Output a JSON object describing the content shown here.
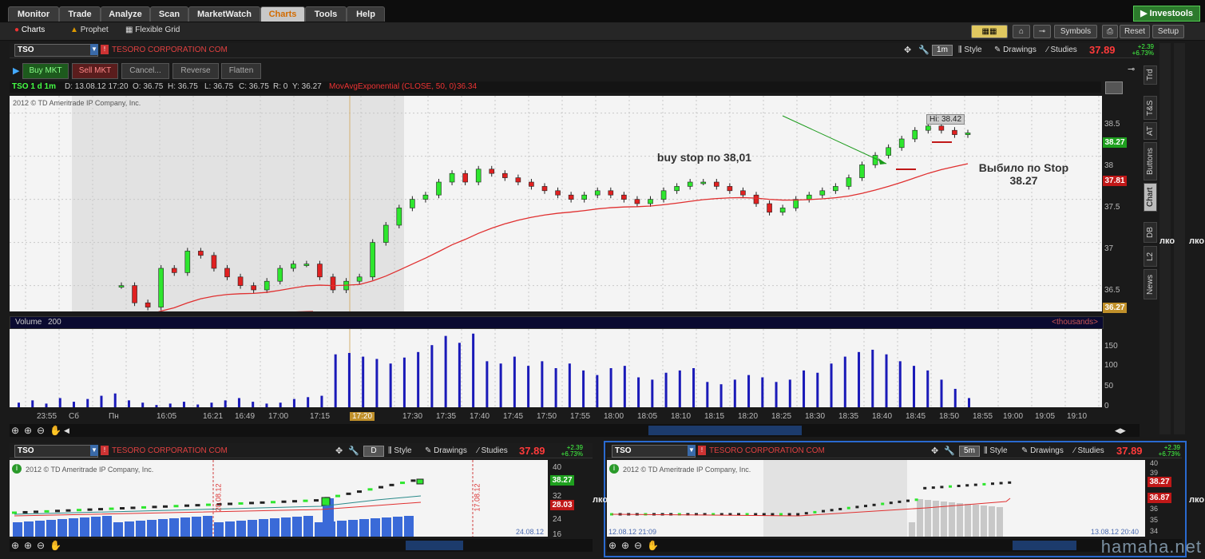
{
  "nav": {
    "tabs": [
      "Monitor",
      "Trade",
      "Analyze",
      "Scan",
      "MarketWatch",
      "Charts",
      "Tools",
      "Help"
    ],
    "active": "Charts",
    "brand": "Investools"
  },
  "subnav": {
    "charts": "Charts",
    "prophet": "Prophet",
    "flexible_grid": "Flexible Grid",
    "symbols": "Symbols",
    "reset": "Reset",
    "setup": "Setup"
  },
  "main_chart": {
    "symbol": "TSO",
    "company": "TESORO CORPORATION COM",
    "timeframe_btn": "1m",
    "style": "Style",
    "drawings": "Drawings",
    "studies": "Studies",
    "last_price": "37.89",
    "change_abs": "+2.39",
    "change_pct": "+6.73%",
    "buy_btn": "Buy MKT",
    "sell_btn": "Sell MKT",
    "cancel_btn": "Cancel...",
    "reverse_btn": "Reverse",
    "flatten_btn": "Flatten",
    "info": {
      "label": "TSO 1 d 1m",
      "date": "D: 13.08.12 17:20",
      "open": "O: 36.75",
      "high": "H: 36.75",
      "low": "L: 36.75",
      "close": "C: 36.75",
      "range": "R: 0",
      "y": "Y: 36.27",
      "study": "MovAvgExponential (CLOSE, 50, 0)",
      "study_val": "36.34"
    },
    "copyright": "2012 © TD Ameritrade IP Company, Inc.",
    "y_axis": [
      "38.5",
      "38",
      "37.5",
      "37",
      "36.5"
    ],
    "tag_last": "38.27",
    "tag_ma": "37.81",
    "tag_y": "36.27",
    "hi_label": "Hi: 38.42",
    "annotation1": "buy stop по 38,01",
    "annotation2_l1": "Выбило по Stop",
    "annotation2_l2": "38.27",
    "volume_label": "Volume",
    "volume_val": "200",
    "volume_units": "<thousands>",
    "volume_axis": [
      "150",
      "100",
      "50",
      "0"
    ],
    "time_labels": [
      "23:55",
      "Сб",
      "Пн",
      "16:05",
      "16:21",
      "16:49",
      "17:00",
      "17:15",
      "17:20",
      "17:30",
      "17:35",
      "17:40",
      "17:45",
      "17:50",
      "17:55",
      "18:00",
      "18:05",
      "18:10",
      "18:15",
      "18:20",
      "18:25",
      "18:30",
      "18:35",
      "18:40",
      "18:45",
      "18:50",
      "18:55",
      "19:00",
      "19:05",
      "19:10"
    ],
    "side_tabs": [
      "Trd",
      "T&S",
      "AT",
      "Buttons",
      "Chart",
      "DB",
      "L2",
      "News"
    ],
    "side_text": "лко"
  },
  "chart_data": [
    {
      "type": "candlestick",
      "title": "TSO 1 d 1m",
      "ylim": [
        36.2,
        38.7
      ],
      "study": "MovAvgExponential (CLOSE, 50, 0)",
      "annotations": [
        "buy stop по 38,01",
        "Выбило по Stop 38.27",
        "Hi: 38.42"
      ],
      "closes": [
        36.5,
        36.3,
        36.25,
        36.7,
        36.65,
        36.9,
        36.85,
        36.7,
        36.6,
        36.5,
        36.45,
        36.55,
        36.7,
        36.75,
        36.75,
        36.6,
        36.45,
        36.55,
        36.6,
        37.0,
        37.2,
        37.4,
        37.5,
        37.55,
        37.7,
        37.8,
        37.7,
        37.85,
        37.8,
        37.75,
        37.7,
        37.65,
        37.6,
        37.55,
        37.5,
        37.55,
        37.6,
        37.55,
        37.5,
        37.45,
        37.5,
        37.6,
        37.65,
        37.7,
        37.7,
        37.65,
        37.6,
        37.55,
        37.45,
        37.35,
        37.4,
        37.5,
        37.55,
        37.6,
        37.65,
        37.75,
        37.9,
        38.01,
        38.1,
        38.2,
        38.3,
        38.35,
        38.3,
        38.25,
        38.27
      ]
    },
    {
      "type": "bar",
      "title": "Volume",
      "values": [
        10,
        15,
        8,
        20,
        12,
        18,
        25,
        30,
        15,
        10,
        5,
        8,
        12,
        6,
        10,
        15,
        20,
        12,
        8,
        10,
        18,
        22,
        25,
        115,
        118,
        110,
        105,
        95,
        108,
        120,
        135,
        155,
        140,
        160,
        100,
        95,
        110,
        90,
        100,
        85,
        95,
        80,
        70,
        85,
        90,
        65,
        60,
        75,
        80,
        85,
        55,
        50,
        60,
        70,
        65,
        55,
        60,
        80,
        75,
        95,
        110,
        120,
        125,
        115,
        100,
        90,
        80,
        60,
        40,
        20
      ]
    }
  ],
  "bottom_left": {
    "symbol": "TSO",
    "company": "TESORO CORPORATION COM",
    "timeframe_btn": "D",
    "style": "Style",
    "drawings": "Drawings",
    "studies": "Studies",
    "last_price": "37.89",
    "change_abs": "+2.39",
    "change_pct": "+6.73%",
    "copyright": "2012 © TD Ameritrade IP Company, Inc.",
    "tag_last": "38.27",
    "tag_other": "28.03",
    "y_axis": [
      "40",
      "32",
      "24",
      "16"
    ],
    "date_left": "20.08.12",
    "date_right": "17.08.12",
    "date_end": "24.08.12"
  },
  "bottom_right": {
    "symbol": "TSO",
    "company": "TESORO CORPORATION COM",
    "timeframe_btn": "5m",
    "style": "Style",
    "drawings": "Drawings",
    "studies": "Studies",
    "last_price": "37.89",
    "change_abs": "+2.39",
    "change_pct": "+6.73%",
    "copyright": "2012 © TD Ameritrade IP Company, Inc.",
    "tag_last": "38.27",
    "tag_other": "36.87",
    "y_axis": [
      "40",
      "39",
      "38",
      "37",
      "36",
      "35",
      "34"
    ],
    "date_left": "12.08.12 21:09",
    "date_right": "13.08.12 20:40"
  },
  "watermark": "hamaha.net"
}
